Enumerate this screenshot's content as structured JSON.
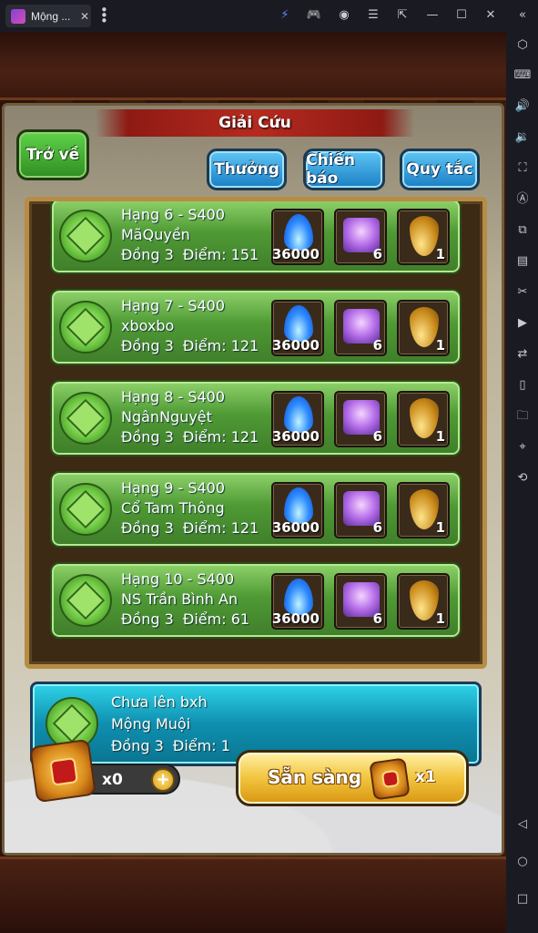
{
  "window": {
    "tab_title": "Mộng ...",
    "tab_close": "✕"
  },
  "game": {
    "title": "Giải Cứu",
    "back_button": "Trở về",
    "tabs": [
      "Thưởng",
      "Chiến báo",
      "Quy tắc"
    ],
    "rankings": [
      {
        "rank": "Hạng 6 - S400",
        "name": "MãQuyền",
        "tier": "Đồng 3",
        "points_label": "Điểm:",
        "points": "151",
        "reward_flame": "36000",
        "reward_chest": "6",
        "reward_drop": "1"
      },
      {
        "rank": "Hạng 7 - S400",
        "name": "xboxbo",
        "tier": "Đồng 3",
        "points_label": "Điểm:",
        "points": "121",
        "reward_flame": "36000",
        "reward_chest": "6",
        "reward_drop": "1"
      },
      {
        "rank": "Hạng 8 - S400",
        "name": "NgânNguyệt",
        "tier": "Đồng 3",
        "points_label": "Điểm:",
        "points": "121",
        "reward_flame": "36000",
        "reward_chest": "6",
        "reward_drop": "1"
      },
      {
        "rank": "Hạng 9 - S400",
        "name": "Cổ Tam Thông",
        "tier": "Đồng 3",
        "points_label": "Điểm:",
        "points": "121",
        "reward_flame": "36000",
        "reward_chest": "6",
        "reward_drop": "1"
      },
      {
        "rank": "Hạng 10 - S400",
        "name": "NS Trần Bình An",
        "tier": "Đồng 3",
        "points_label": "Điểm:",
        "points": "61",
        "reward_flame": "36000",
        "reward_chest": "6",
        "reward_drop": "1"
      }
    ],
    "self": {
      "status": "Chưa lên bxh",
      "name": "Mộng Muội",
      "tier": "Đồng 3",
      "points_label": "Điểm:",
      "points": "1"
    },
    "ticket_count": "x0",
    "plus": "+",
    "ready_button": "Sẵn sàng",
    "ready_cost": "x1"
  }
}
